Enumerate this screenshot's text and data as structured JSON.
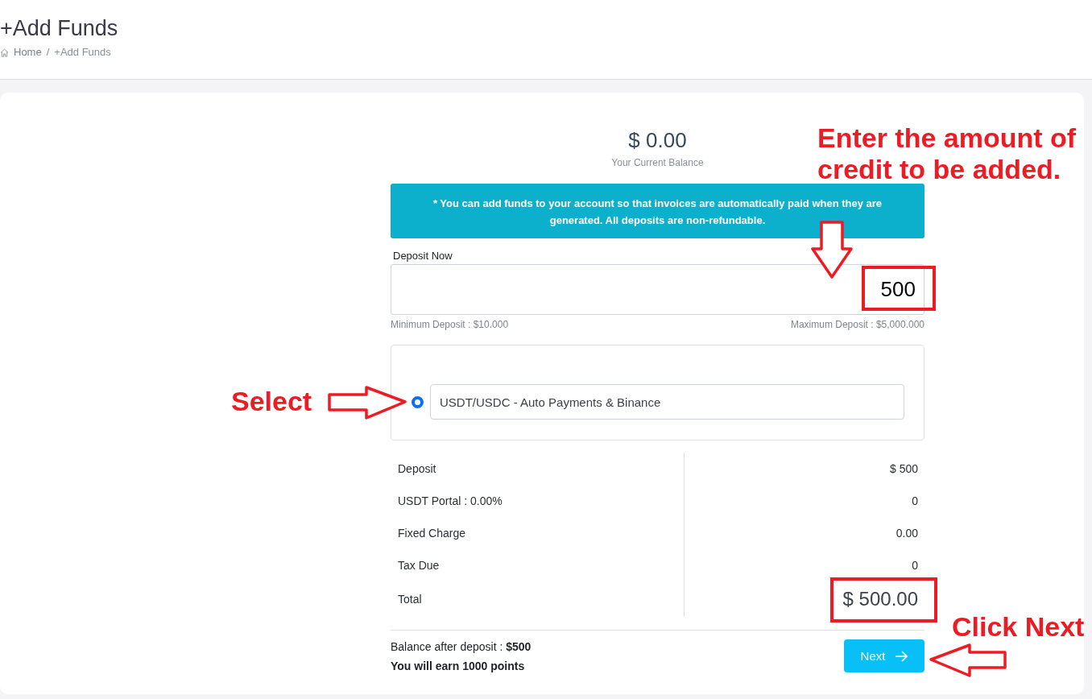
{
  "header": {
    "title": "+Add Funds",
    "breadcrumb": {
      "items": [
        "Home",
        "+Add Funds"
      ],
      "separator": "/"
    }
  },
  "balance": {
    "amount": "$ 0.00",
    "label": "Your Current Balance"
  },
  "notice": "* You can add funds to your account so that invoices are automatically paid when they are generated. All deposits are non-refundable.",
  "deposit": {
    "label": "Deposit Now",
    "value": "500",
    "minimum": "Minimum Deposit : $10.000",
    "maximum": "Maximum Deposit : $5,000.000"
  },
  "payment_methods": [
    {
      "label": "USDT/USDC - Auto Payments & Binance",
      "selected": true
    }
  ],
  "summary": [
    {
      "kind": "line",
      "label": "Deposit",
      "value": "$ 500"
    },
    {
      "kind": "line",
      "label": "USDT Portal : 0.00%",
      "value": "0"
    },
    {
      "kind": "line",
      "label": "Fixed Charge",
      "value": "0.00"
    },
    {
      "kind": "line",
      "label": "Tax Due",
      "value": "0"
    },
    {
      "kind": "total",
      "label": "Total",
      "value": "$ 500.00"
    }
  ],
  "footer": {
    "balance_after": "Balance after deposit : **$500**",
    "points": "You will earn 1000 points",
    "next_button": "Next"
  },
  "callouts": [
    {
      "text": "Enter the amount of credit to be added."
    },
    {
      "text": "Select"
    },
    {
      "text": "Click Next"
    }
  ]
}
